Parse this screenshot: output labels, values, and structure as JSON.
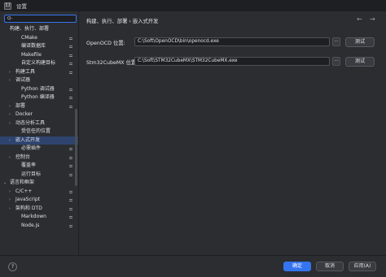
{
  "window": {
    "title": "设置",
    "app_icon_text": "IJ"
  },
  "search": {
    "value": "Q-"
  },
  "sidebar": {
    "items": [
      {
        "label": "构建、执行、部署",
        "arrow": "",
        "marker": false,
        "selected": false,
        "indent": 0
      },
      {
        "label": "CMake",
        "arrow": "",
        "marker": true,
        "selected": false,
        "indent": 2
      },
      {
        "label": "编译数据库",
        "arrow": "",
        "marker": true,
        "selected": false,
        "indent": 2
      },
      {
        "label": "Makefile",
        "arrow": "",
        "marker": true,
        "selected": false,
        "indent": 2
      },
      {
        "label": "自定义构建目标",
        "arrow": "",
        "marker": true,
        "selected": false,
        "indent": 2
      },
      {
        "label": "构建工具",
        "arrow": "›",
        "marker": true,
        "selected": false,
        "indent": 1
      },
      {
        "label": "调试器",
        "arrow": "›",
        "marker": false,
        "selected": false,
        "indent": 1
      },
      {
        "label": "Python 调试器",
        "arrow": "",
        "marker": true,
        "selected": false,
        "indent": 2
      },
      {
        "label": "Python 编译器",
        "arrow": "",
        "marker": true,
        "selected": false,
        "indent": 2
      },
      {
        "label": "部署",
        "arrow": "›",
        "marker": true,
        "selected": false,
        "indent": 1
      },
      {
        "label": "Docker",
        "arrow": "›",
        "marker": false,
        "selected": false,
        "indent": 1
      },
      {
        "label": "动态分析工具",
        "arrow": "›",
        "marker": false,
        "selected": false,
        "indent": 1
      },
      {
        "label": "受信任的位置",
        "arrow": "",
        "marker": false,
        "selected": false,
        "indent": 2
      },
      {
        "label": "嵌入式开发",
        "arrow": "›",
        "marker": false,
        "selected": true,
        "indent": 1
      },
      {
        "label": "必需插件",
        "arrow": "",
        "marker": true,
        "selected": false,
        "indent": 2
      },
      {
        "label": "控制台",
        "arrow": "›",
        "marker": true,
        "selected": false,
        "indent": 1
      },
      {
        "label": "覆盖率",
        "arrow": "",
        "marker": true,
        "selected": false,
        "indent": 2
      },
      {
        "label": "运行目标",
        "arrow": "",
        "marker": true,
        "selected": false,
        "indent": 2
      },
      {
        "label": "语言和框架",
        "arrow": "⌄",
        "marker": false,
        "selected": false,
        "indent": 0
      },
      {
        "label": "C/C++",
        "arrow": "›",
        "marker": true,
        "selected": false,
        "indent": 1
      },
      {
        "label": "JavaScript",
        "arrow": "›",
        "marker": true,
        "selected": false,
        "indent": 1
      },
      {
        "label": "架构和 DTD",
        "arrow": "›",
        "marker": true,
        "selected": false,
        "indent": 1
      },
      {
        "label": "Markdown",
        "arrow": "",
        "marker": true,
        "selected": false,
        "indent": 2
      },
      {
        "label": "Node.js",
        "arrow": "",
        "marker": true,
        "selected": false,
        "indent": 2
      }
    ]
  },
  "content": {
    "breadcrumb": "构建、执行、部署 › 嵌入式开发",
    "nav_back": "←",
    "nav_forward": "→",
    "rows": [
      {
        "label": "OpenOCD 位置:",
        "value": "C:\\Soft\\OpenOCD\\bin\\openocd.exe",
        "browse": "...",
        "test": "测试"
      },
      {
        "label": "Stm32CubeMX 位置:",
        "value": "C:\\Soft\\STM32CubeMX\\STM32CubeMX.exe",
        "browse": "...",
        "test": "测试"
      }
    ]
  },
  "footer": {
    "help": "?",
    "ok": "确定",
    "cancel": "取消",
    "apply": "应用(A)"
  },
  "colors": {
    "background": "#2b2d30",
    "field": "#1e1f22",
    "selection": "#2e436e",
    "accent": "#3574f0",
    "text": "#dfe1e5"
  }
}
